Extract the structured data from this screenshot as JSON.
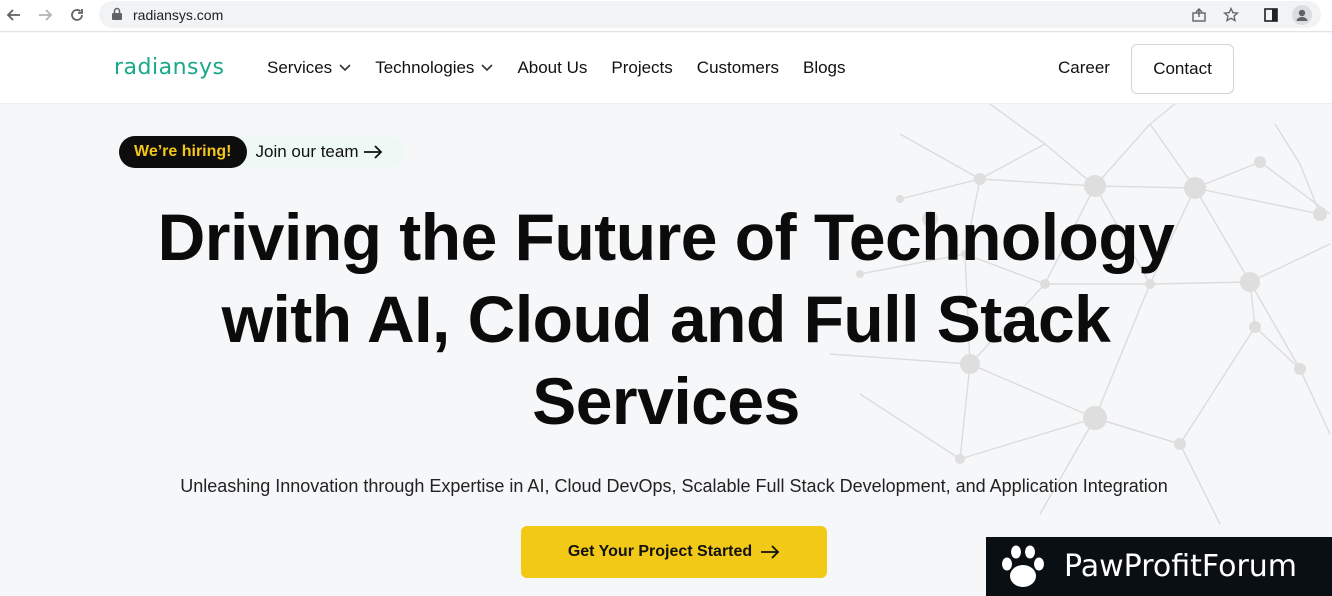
{
  "browser": {
    "url": "radiansys.com"
  },
  "header": {
    "logo": "radiansys",
    "menu": [
      "Services",
      "Technologies",
      "About Us",
      "Projects",
      "Customers",
      "Blogs"
    ],
    "career": "Career",
    "contact": "Contact"
  },
  "hero": {
    "hiring_badge": "We’re hiring!",
    "join_link": "Join our team",
    "headline_line1": "Driving the Future of Technology",
    "headline_line2": "with AI, Cloud and Full Stack",
    "headline_line3": "Services",
    "subtitle": "Unleashing Innovation through Expertise in AI, Cloud DevOps, Scalable Full Stack Development, and Application Integration",
    "cta": "Get Your Project Started"
  },
  "watermark": {
    "text": "PawProfitForum"
  },
  "colors": {
    "brand": "#1aa88a",
    "accent": "#f2c917",
    "hiring_text": "#f5c518"
  }
}
